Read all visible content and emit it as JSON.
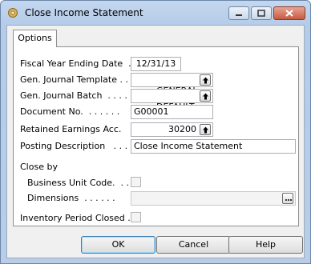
{
  "window": {
    "title": "Close Income Statement"
  },
  "tabs": [
    {
      "label": "Options"
    }
  ],
  "fields": {
    "fiscal_year_ending_date": {
      "label": "Fiscal Year Ending Date  .",
      "value": "12/31/13"
    },
    "gen_journal_template": {
      "label": "Gen. Journal Template . .",
      "value": "GENERAL"
    },
    "gen_journal_batch": {
      "label": "Gen. Journal Batch  . . . .",
      "value": "DEFAULT"
    },
    "document_no": {
      "label": "Document No.  . . . . . .",
      "value": "G00001"
    },
    "retained_earnings_acc": {
      "label": "Retained Earnings Acc.   .",
      "value": "30200"
    },
    "posting_description": {
      "label": "Posting Description   . . .",
      "value": "Close Income Statement"
    }
  },
  "close_by": {
    "heading": "Close by",
    "business_unit_code": {
      "label": "Business Unit Code.  . .",
      "checked": false
    },
    "dimensions": {
      "label": "Dimensions  . . . . . .",
      "value": ""
    }
  },
  "inventory_period_closed": {
    "label": "Inventory Period Closed .",
    "checked": false
  },
  "buttons": {
    "ok": "OK",
    "cancel": "Cancel",
    "help": "Help"
  },
  "icons": {
    "app": "gear-icon",
    "lookup": "lookup-arrow-icon",
    "assist": "ellipsis-icon",
    "minimize": "minimize-icon",
    "maximize": "maximize-icon",
    "close": "close-icon"
  }
}
